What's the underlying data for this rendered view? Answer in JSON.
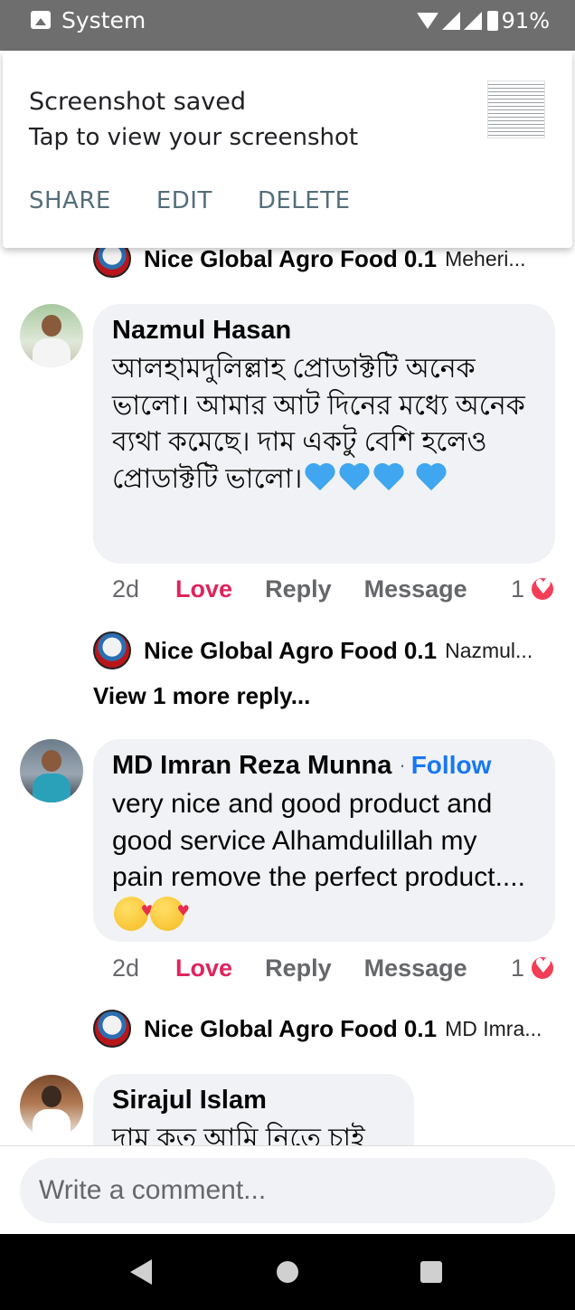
{
  "status_bar": {
    "app_label": "System",
    "battery": "91%"
  },
  "notification": {
    "title": "Screenshot saved",
    "subtitle": "Tap to view your screenshot",
    "actions": [
      "SHARE",
      "EDIT",
      "DELETE"
    ]
  },
  "page_name": "Nice Global Agro Food 0.1",
  "reply_previews": [
    {
      "target": "Meheri..."
    },
    {
      "target": "Nazmul..."
    },
    {
      "target": "MD Imra..."
    }
  ],
  "comments": [
    {
      "author": "Nazmul Hasan",
      "text": "আলহামদুলিল্লাহ প্রোডাক্টটি অনেক ভালো। আমার  আট দিনের মধ্যে অনেক ব্যথা কমেছে। দাম একটু বেশি হলেও প্রোডাক্টটি ভালো।",
      "emoji": "blue-heart x4",
      "time": "2d",
      "reaction_count": "1"
    },
    {
      "author": "MD Imran Reza Munna",
      "follow_label": "Follow",
      "text": "very nice and good product and good service Alhamdulillah  my pain remove the perfect product....",
      "emoji": "smiling-face-with-hearts x2",
      "time": "2d",
      "reaction_count": "1"
    },
    {
      "author": "Sirajul Islam",
      "text": "দাম কত আমি  নিতে চাই"
    }
  ],
  "actions": {
    "love": "Love",
    "reply": "Reply",
    "message": "Message"
  },
  "view_more": "View 1 more reply...",
  "composer": {
    "placeholder": "Write a comment..."
  },
  "colors": {
    "status_bar": "#6e6e6e",
    "notification_action": "#546e7a",
    "love": "#e0245e",
    "follow": "#1877f2",
    "bubble": "#f0f2f5"
  }
}
